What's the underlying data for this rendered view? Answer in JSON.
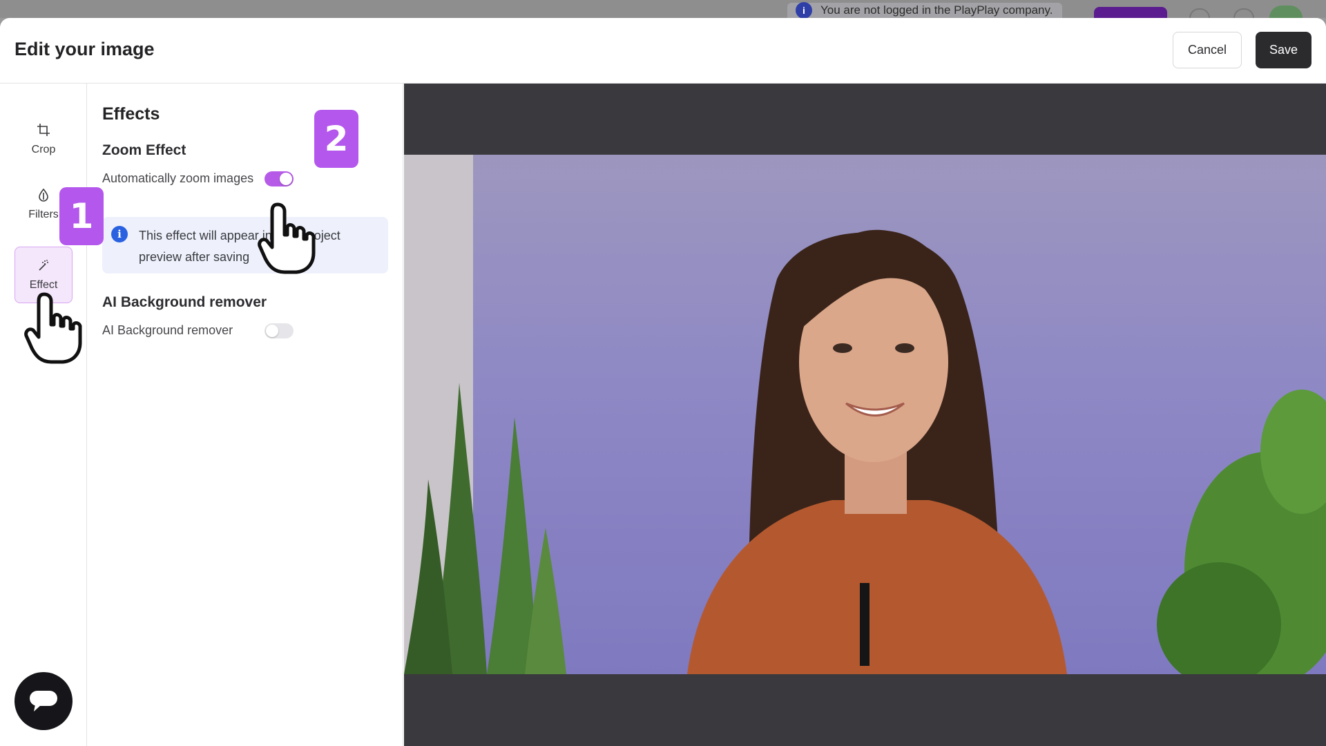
{
  "background_app": {
    "notice_text": "You are not logged in the PlayPlay company."
  },
  "modal": {
    "title": "Edit your image",
    "cancel_label": "Cancel",
    "save_label": "Save"
  },
  "tools": [
    {
      "label": "Crop",
      "icon": "crop-icon",
      "active": false
    },
    {
      "label": "Filters",
      "icon": "drop-icon",
      "active": false
    },
    {
      "label": "Effect",
      "icon": "magic-wand-icon",
      "active": true
    }
  ],
  "effects_panel": {
    "title": "Effects",
    "zoom_section": {
      "title": "Zoom Effect",
      "toggle_label": "Automatically zoom images",
      "toggle_on": true,
      "info_text": "This effect will appear in your project preview after saving"
    },
    "bg_remover_section": {
      "title": "AI Background remover",
      "toggle_label": "AI Background remover",
      "toggle_on": false
    }
  },
  "annotations": {
    "step_1": "1",
    "step_2": "2"
  },
  "colors": {
    "accent": "#b65be8",
    "badge": "#b457ec",
    "save_button": "#2b2b2e",
    "info_box": "#eef1fc",
    "info_icon": "#2a61e0",
    "preview_background": "#3a3a3e"
  }
}
